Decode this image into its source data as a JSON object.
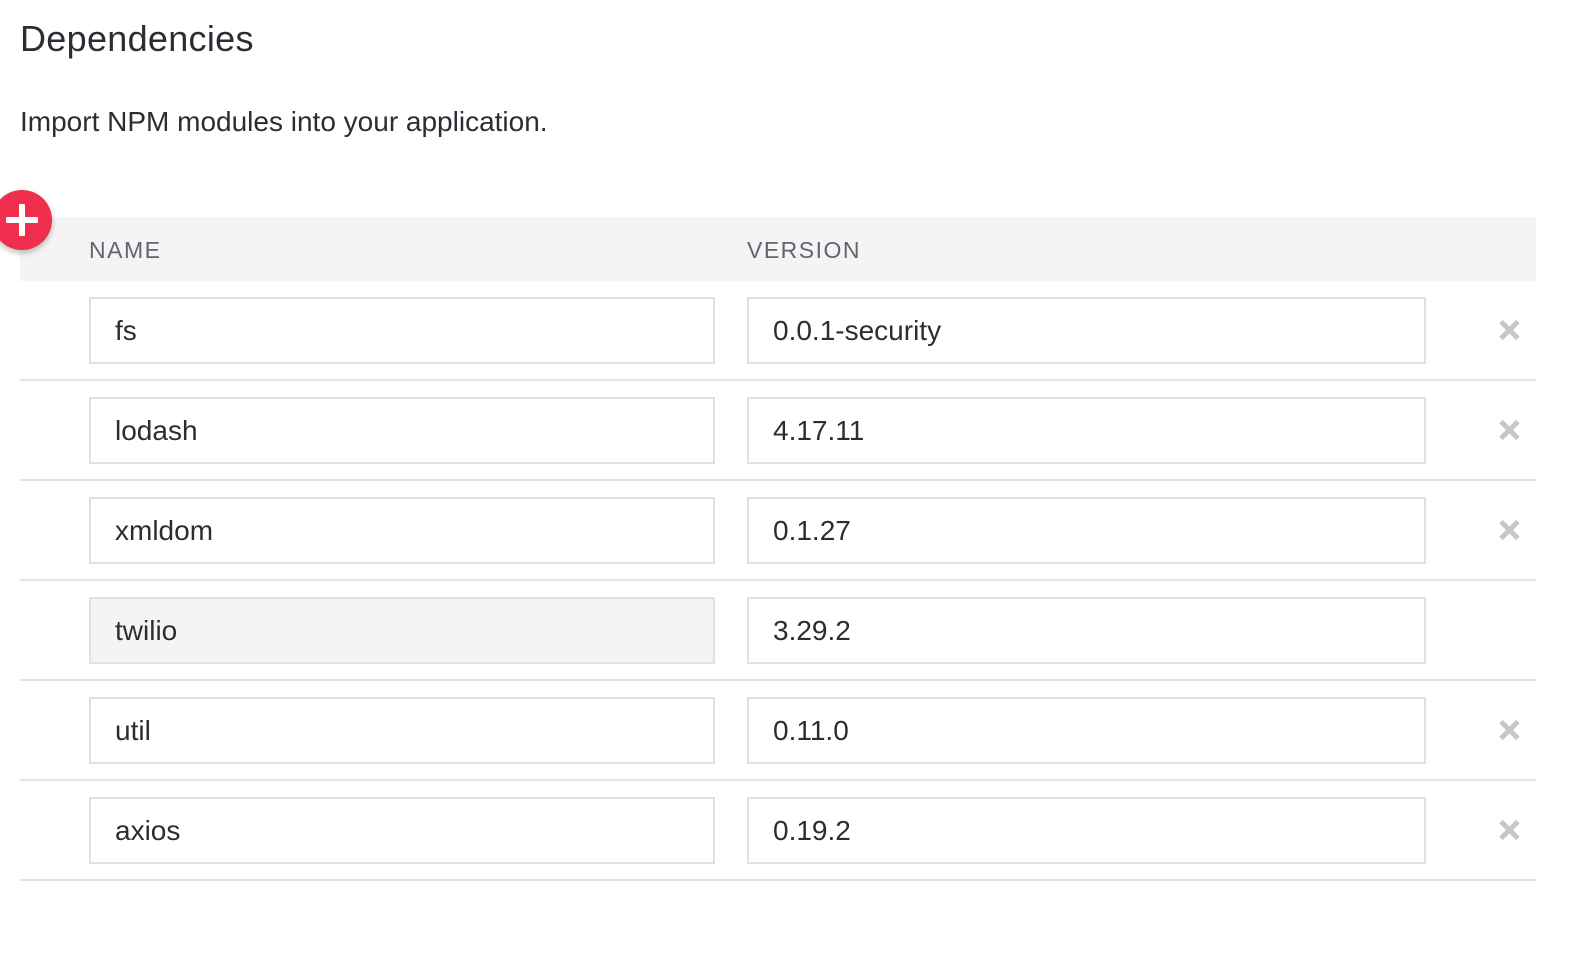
{
  "page": {
    "title": "Dependencies",
    "description": "Import NPM modules into your application."
  },
  "table": {
    "headers": {
      "name": "NAME",
      "version": "VERSION"
    },
    "rows": [
      {
        "name": "fs",
        "version": "0.0.1-security",
        "removable": true,
        "name_locked": false
      },
      {
        "name": "lodash",
        "version": "4.17.11",
        "removable": true,
        "name_locked": false
      },
      {
        "name": "xmldom",
        "version": "0.1.27",
        "removable": true,
        "name_locked": false
      },
      {
        "name": "twilio",
        "version": "3.29.2",
        "removable": false,
        "name_locked": true
      },
      {
        "name": "util",
        "version": "0.11.0",
        "removable": true,
        "name_locked": false
      },
      {
        "name": "axios",
        "version": "0.19.2",
        "removable": true,
        "name_locked": false
      }
    ]
  },
  "icons": {
    "add": "plus-icon",
    "remove": "close-icon"
  },
  "colors": {
    "accent": "#ef2f4d",
    "header_background": "#f4f4f4",
    "locked_field_background": "#f4f4f4"
  }
}
